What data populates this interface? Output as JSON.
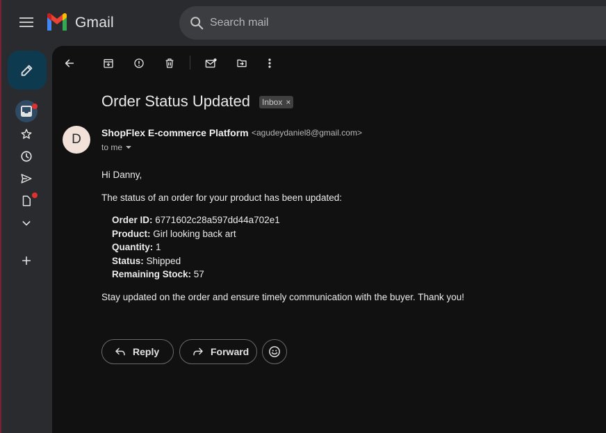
{
  "app": {
    "brand": "Gmail",
    "colors": {
      "compose_bg": "#0e3a4f",
      "active_rail_bg": "#2f4a63",
      "notification_dot": "#e0312f",
      "pane_bg": "#111111"
    }
  },
  "search": {
    "placeholder": "Search mail"
  },
  "rail": {
    "items": [
      {
        "icon": "inbox-icon",
        "badge": true,
        "active": true
      },
      {
        "icon": "star-icon"
      },
      {
        "icon": "clock-icon"
      },
      {
        "icon": "send-icon"
      },
      {
        "icon": "document-icon",
        "badge": true
      },
      {
        "icon": "chevron-down-icon"
      },
      {
        "icon": "plus-icon"
      }
    ]
  },
  "toolbar": {
    "icons": [
      "back-arrow-icon",
      "archive-icon",
      "report-spam-icon",
      "trash-icon",
      "mark-unread-icon",
      "move-to-icon",
      "more-vert-icon"
    ]
  },
  "email": {
    "subject": "Order Status Updated",
    "label": "Inbox",
    "label_close": "×",
    "avatar_letter": "D",
    "sender_name": "ShopFlex E-commerce Platform",
    "sender_email": "<agudeydaniel8@gmail.com>",
    "recipient": "to me",
    "greeting": "Hi Danny,",
    "intro": "The status of an order for your product has been updated:",
    "details": [
      {
        "key": "Order ID:",
        "value": "6771602c28a597dd44a702e1"
      },
      {
        "key": "Product:",
        "value": "Girl looking back art"
      },
      {
        "key": "Quantity:",
        "value": "1"
      },
      {
        "key": "Status:",
        "value": "Shipped"
      },
      {
        "key": "Remaining Stock:",
        "value": "57"
      }
    ],
    "closing": "Stay updated on the order and ensure timely communication with the buyer. Thank you!"
  },
  "actions": {
    "reply": "Reply",
    "forward": "Forward"
  }
}
